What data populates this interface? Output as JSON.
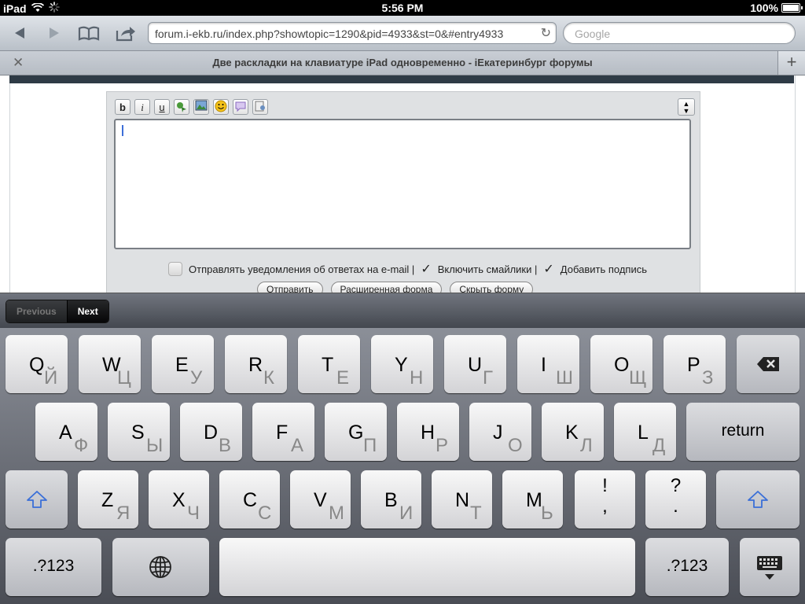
{
  "status": {
    "device": "iPad",
    "time": "5:56 PM",
    "battery": "100%",
    "battery_level": 1.0
  },
  "browser": {
    "url": "forum.i-ekb.ru/index.php?showtopic=1290&pid=4933&st=0&#entry4933",
    "search_placeholder": "Google",
    "tab_title": "Две раскладки на клавиатуре iPad одновременно - iЕкатеринбург форумы"
  },
  "form": {
    "options": {
      "notify_label": "Отправлять уведомления об ответах на e-mail |",
      "smilies_label": "Включить смайлики |",
      "signature_label": "Добавить подпись"
    },
    "buttons": {
      "submit": "Отправить",
      "advanced": "Расширенная форма",
      "hide": "Скрыть форму"
    }
  },
  "form_assistant": {
    "previous": "Previous",
    "next": "Next"
  },
  "keyboard": {
    "row1": [
      {
        "lat": "Q",
        "cyr": "Й"
      },
      {
        "lat": "W",
        "cyr": "Ц"
      },
      {
        "lat": "E",
        "cyr": "У"
      },
      {
        "lat": "R",
        "cyr": "К"
      },
      {
        "lat": "T",
        "cyr": "Е"
      },
      {
        "lat": "Y",
        "cyr": "Н"
      },
      {
        "lat": "U",
        "cyr": "Г"
      },
      {
        "lat": "I",
        "cyr": "Ш"
      },
      {
        "lat": "O",
        "cyr": "Щ"
      },
      {
        "lat": "P",
        "cyr": "З"
      }
    ],
    "row2": [
      {
        "lat": "A",
        "cyr": "Ф"
      },
      {
        "lat": "S",
        "cyr": "Ы"
      },
      {
        "lat": "D",
        "cyr": "В"
      },
      {
        "lat": "F",
        "cyr": "А"
      },
      {
        "lat": "G",
        "cyr": "П"
      },
      {
        "lat": "H",
        "cyr": "Р"
      },
      {
        "lat": "J",
        "cyr": "О"
      },
      {
        "lat": "K",
        "cyr": "Л"
      },
      {
        "lat": "L",
        "cyr": "Д"
      }
    ],
    "row3": [
      {
        "lat": "Z",
        "cyr": "Я"
      },
      {
        "lat": "X",
        "cyr": "Ч"
      },
      {
        "lat": "C",
        "cyr": "С"
      },
      {
        "lat": "V",
        "cyr": "М"
      },
      {
        "lat": "B",
        "cyr": "И"
      },
      {
        "lat": "N",
        "cyr": "Т"
      },
      {
        "lat": "M",
        "cyr": "Ь"
      }
    ],
    "exclam_top": "!",
    "exclam_bottom": ",",
    "question_top": "?",
    "question_bottom": ".",
    "return_label": "return",
    "numbers_label": ".?123"
  }
}
